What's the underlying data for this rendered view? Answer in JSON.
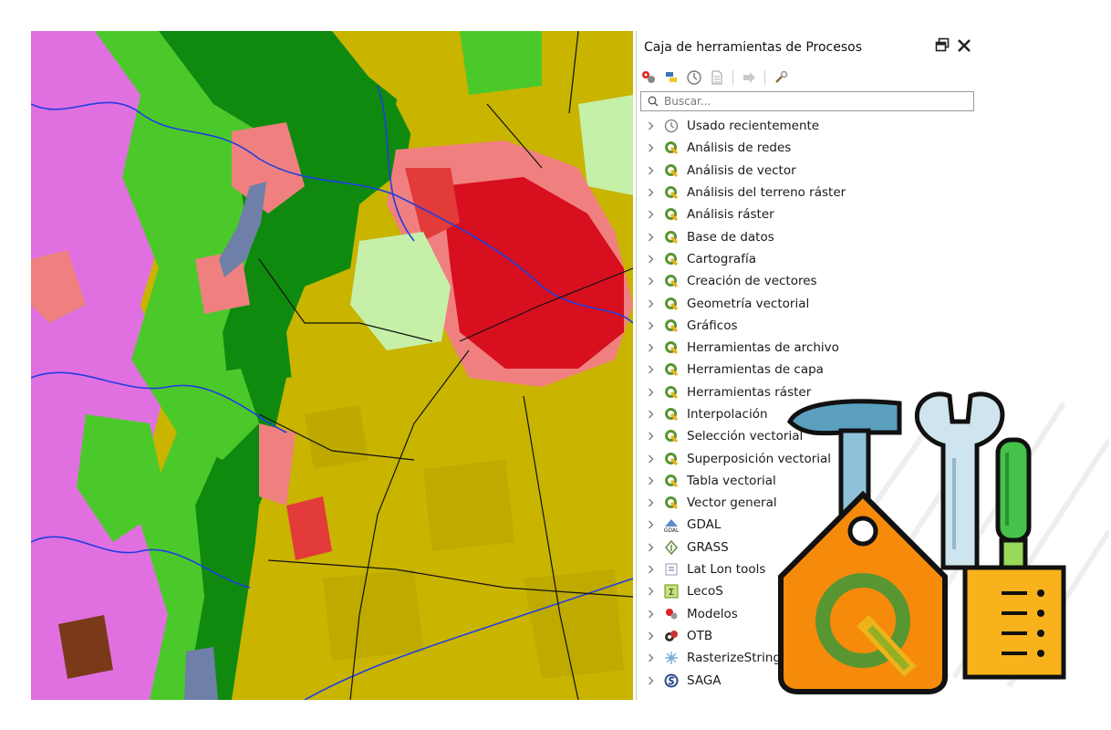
{
  "panel": {
    "title": "Caja de herramientas de Procesos",
    "controls": {
      "float": "float-window-icon",
      "close": "close-icon"
    },
    "toolbar": [
      {
        "name": "models-icon"
      },
      {
        "name": "python-scripts-icon"
      },
      {
        "name": "history-icon"
      },
      {
        "name": "results-viewer-icon"
      },
      {
        "name": "edit-features-in-place-icon"
      },
      {
        "name": "options-wrench-icon"
      }
    ],
    "search": {
      "placeholder": "Buscar..."
    }
  },
  "tree": [
    {
      "label": "Usado recientemente",
      "icon": "clock-icon"
    },
    {
      "label": "Análisis de redes",
      "icon": "qgis-icon"
    },
    {
      "label": "Análisis de vector",
      "icon": "qgis-icon"
    },
    {
      "label": "Análisis del terreno ráster",
      "icon": "qgis-icon"
    },
    {
      "label": "Análisis ráster",
      "icon": "qgis-icon"
    },
    {
      "label": "Base de datos",
      "icon": "qgis-icon"
    },
    {
      "label": "Cartografía",
      "icon": "qgis-icon"
    },
    {
      "label": "Creación de vectores",
      "icon": "qgis-icon"
    },
    {
      "label": "Geometría vectorial",
      "icon": "qgis-icon"
    },
    {
      "label": "Gráficos",
      "icon": "qgis-icon"
    },
    {
      "label": "Herramientas de archivo",
      "icon": "qgis-icon"
    },
    {
      "label": "Herramientas de capa",
      "icon": "qgis-icon"
    },
    {
      "label": "Herramientas ráster",
      "icon": "qgis-icon"
    },
    {
      "label": "Interpolación",
      "icon": "qgis-icon"
    },
    {
      "label": "Selección vectorial",
      "icon": "qgis-icon"
    },
    {
      "label": "Superposición vectorial",
      "icon": "qgis-icon"
    },
    {
      "label": "Tabla vectorial",
      "icon": "qgis-icon"
    },
    {
      "label": "Vector general",
      "icon": "qgis-icon"
    },
    {
      "label": "GDAL",
      "icon": "gdal-icon"
    },
    {
      "label": "GRASS",
      "icon": "grass-icon"
    },
    {
      "label": "Lat Lon tools",
      "icon": "latlon-icon"
    },
    {
      "label": "LecoS",
      "icon": "lecos-icon"
    },
    {
      "label": "Modelos",
      "icon": "models-icon"
    },
    {
      "label": "OTB",
      "icon": "otb-icon"
    },
    {
      "label": "RasterizeStrings",
      "icon": "rasterize-icon"
    },
    {
      "label": "SAGA",
      "icon": "saga-icon"
    }
  ],
  "colors": {
    "agriculture": "#c9b400",
    "forest_dark": "#0f8a0f",
    "forest_light": "#4cc92a",
    "grassland": "#c6f0a8",
    "wetland_magenta": "#e070e0",
    "urban": "#d80f1e",
    "urban_light": "#f08080",
    "water": "#6e7fa8",
    "rivers": "#1f3ee0",
    "qgis_green": "#589632",
    "logo_orange": "#f58a0b"
  }
}
